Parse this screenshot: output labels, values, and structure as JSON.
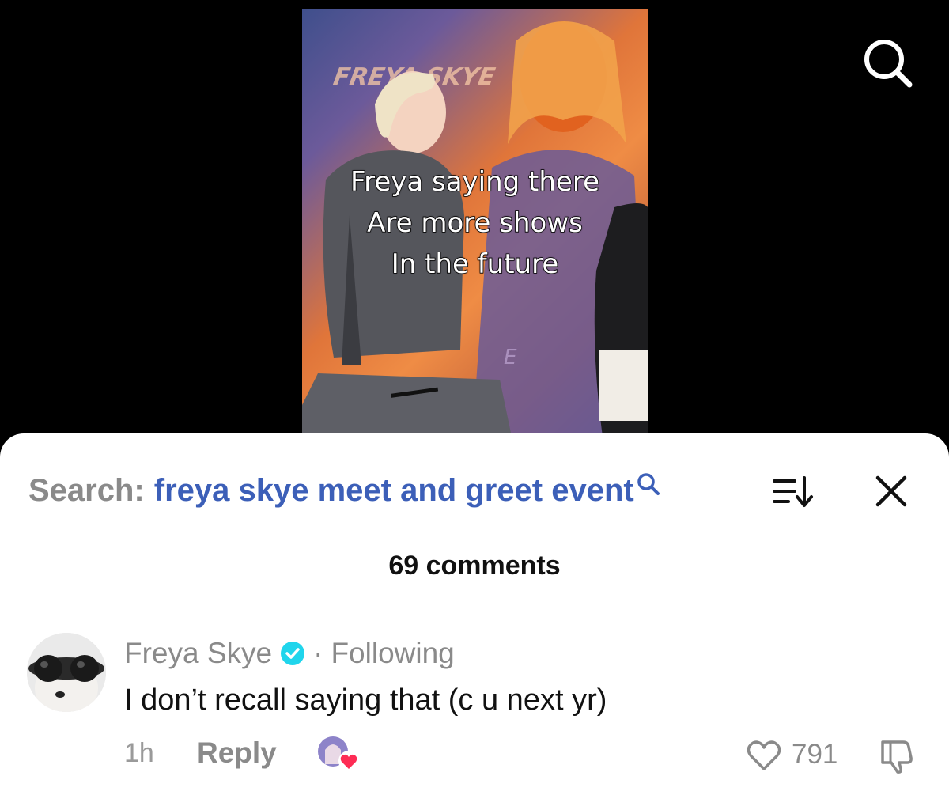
{
  "video": {
    "banner_text": "FREYA SKYE",
    "banner_small": "E",
    "caption_lines": [
      "Freya saying there",
      "Are more shows",
      "In the future"
    ]
  },
  "top_bar": {
    "icon": "search-icon"
  },
  "comments_sheet": {
    "search_prefix": "Search:",
    "search_query": "freya skye meet and greet event",
    "count_label": "69 comments",
    "comments": [
      {
        "author": "Freya Skye",
        "verified": true,
        "relationship": "Following",
        "separator": "·",
        "text": "I don’t recall saying that (c u next yr)",
        "time": "1h",
        "reply_label": "Reply",
        "likes": "791"
      }
    ]
  },
  "colors": {
    "query": "#3c5fb8",
    "muted": "#8a8a8a",
    "verified": "#20d5ec",
    "heart": "#fe2c55"
  }
}
